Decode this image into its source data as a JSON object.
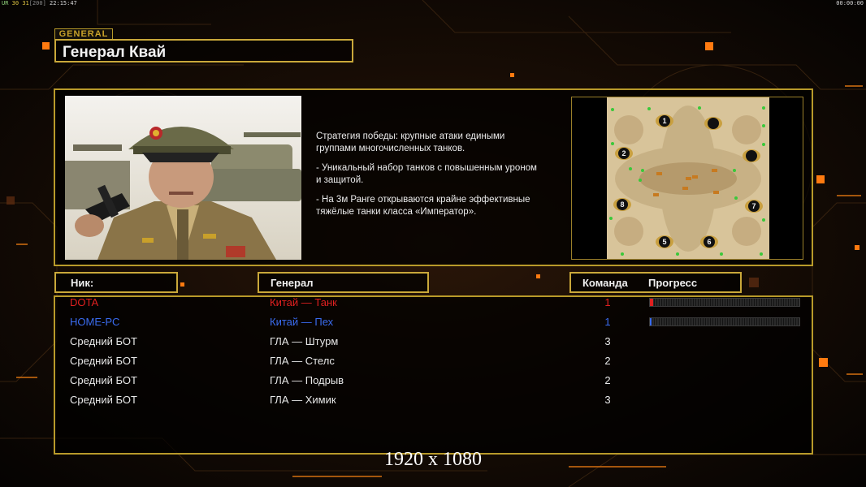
{
  "hud": {
    "left": {
      "a": "UR",
      "b": "30",
      "c": "31",
      "d": "[200]",
      "time": "22:15:47"
    },
    "right_time": "00:00:00"
  },
  "header": {
    "tab_label": "GENERAL",
    "title": "Генерал Квай"
  },
  "general": {
    "description": [
      "Стратегия победы: крупные атаки едиными\n группами многочисленных танков.",
      "- Уникальный набор танков с повышенным уроном\n и защитой.",
      "- На 3м Ранге открываются крайне эффективные\n тяжёлые танки класса «Император»."
    ]
  },
  "map": {
    "spawn_labels": [
      "1",
      "2",
      "5",
      "6",
      "7",
      "8"
    ]
  },
  "lobby": {
    "columns": {
      "nick": "Ник:",
      "general": "Генерал",
      "team": "Команда",
      "progress": "Прогресс"
    },
    "players": [
      {
        "name": "DOTA",
        "general": "Китай — Танк",
        "team": "1",
        "color": "#e02020",
        "progress": 0.02,
        "show_progress": true
      },
      {
        "name": "HOME-PC",
        "general": "Китай — Пех",
        "team": "1",
        "color": "#3a6cf0",
        "progress": 0.01,
        "show_progress": true
      },
      {
        "name": "Средний БОТ",
        "general": "ГЛА — Штурм",
        "team": "3",
        "color": "#e8e8e8",
        "progress": 0,
        "show_progress": false
      },
      {
        "name": "Средний БОТ",
        "general": "ГЛА — Стелс",
        "team": "2",
        "color": "#e8e8e8",
        "progress": 0,
        "show_progress": false
      },
      {
        "name": "Средний БОТ",
        "general": "ГЛА — Подрыв",
        "team": "2",
        "color": "#e8e8e8",
        "progress": 0,
        "show_progress": false
      },
      {
        "name": "Средний БОТ",
        "general": "ГЛА — Химик",
        "team": "3",
        "color": "#e8e8e8",
        "progress": 0,
        "show_progress": false
      }
    ]
  },
  "resolution_caption": "1920 x 1080",
  "colors": {
    "accent": "#c9a83a",
    "background": "#0a0604",
    "highlight_orange": "#ff7a10"
  }
}
